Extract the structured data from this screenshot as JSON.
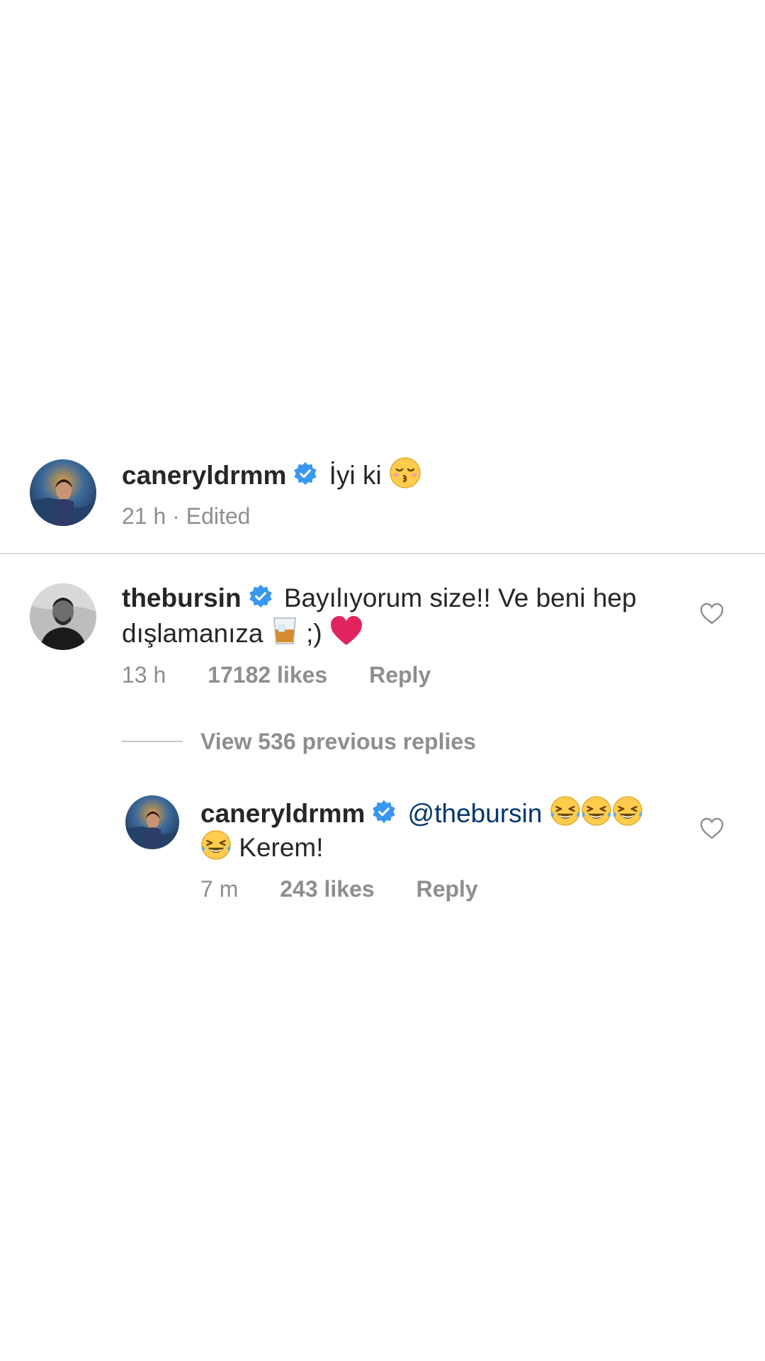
{
  "caption": {
    "username": "caneryldrmm",
    "text": "İyi ki",
    "emoji": "kissing-face-closed-eyes-emoji",
    "time": "21 h",
    "separator": "·",
    "edited": "Edited"
  },
  "comment": {
    "username": "thebursin",
    "text_line1": "Bayılıyorum size!! Ve beni hep",
    "text_line2_a": "dışlamanıza",
    "text_line2_b": ";)",
    "emojis": [
      "tumbler-glass-emoji",
      "red-heart-emoji"
    ],
    "time": "13 h",
    "likes": "17182 likes",
    "reply": "Reply"
  },
  "view_replies": "View 536 previous replies",
  "reply": {
    "username": "caneryldrmm",
    "mention": "@thebursin",
    "text_line2": "Kerem!",
    "emojis": [
      "laughing-tears-emoji",
      "laughing-tears-emoji",
      "laughing-tears-emoji",
      "laughing-tears-emoji"
    ],
    "time": "7 m",
    "likes": "243 likes",
    "reply": "Reply"
  },
  "colors": {
    "verified": "#3897f0",
    "meta": "#8e8e8e",
    "mention": "#00376b",
    "heart_emoji": "#e0245e"
  },
  "icons": [
    "verified-badge-icon",
    "heart-outline-icon"
  ]
}
